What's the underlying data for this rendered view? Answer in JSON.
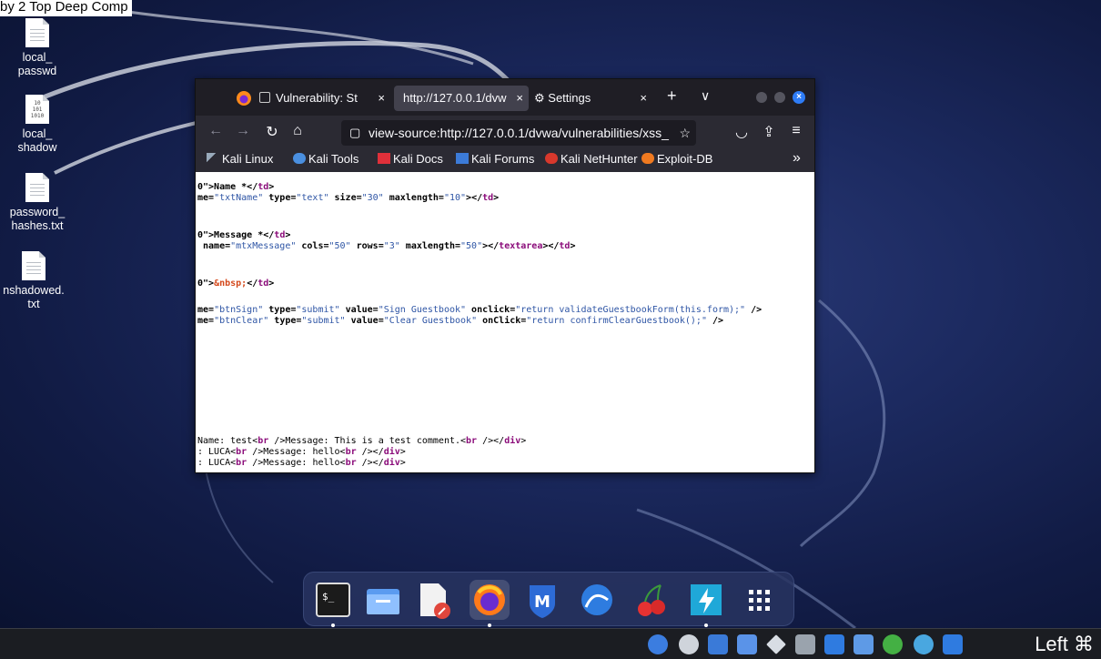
{
  "caption": "by 2 Top Deep Comp",
  "desktop_icons": [
    {
      "label1": "local_",
      "label2": "passwd",
      "kind": "text"
    },
    {
      "label1": "local_",
      "label2": "shadow",
      "kind": "binary"
    },
    {
      "label1": "password_",
      "label2": "hashes.txt",
      "kind": "text"
    },
    {
      "label1": "nshadowed.",
      "label2": "txt",
      "kind": "text"
    }
  ],
  "browser": {
    "tabs": [
      {
        "label": "Vulnerability: St"
      },
      {
        "label": "http://127.0.0.1/dvw"
      },
      {
        "label": "Settings"
      }
    ],
    "new_tab": "+",
    "tab_list": "∨",
    "url": "view-source:http://127.0.0.1/dvwa/vulnerabilities/xss_",
    "bookmarks": [
      "Kali Linux",
      "Kali Tools",
      "Kali Docs",
      "Kali Forums",
      "Kali NetHunter",
      "Exploit-DB"
    ],
    "bookmarks_overflow": "»"
  },
  "source_lines": {
    "l1a": "0\">Name *</",
    "l1b": "td",
    "l1c": ">",
    "l2a": "me=",
    "l2b": "\"txtName\"",
    "l2c": " type=",
    "l2d": "\"text\"",
    "l2e": " size=",
    "l2f": "\"30\"",
    "l2g": " maxlength=",
    "l2h": "\"10\"",
    "l2i": "></",
    "l2j": "td",
    "l2k": ">",
    "l3a": "0\">Message *</",
    "l3b": "td",
    "l3c": ">",
    "l4a": " name=",
    "l4b": "\"mtxMessage\"",
    "l4c": " cols=",
    "l4d": "\"50\"",
    "l4e": " rows=",
    "l4f": "\"3\"",
    "l4g": " maxlength=",
    "l4h": "\"50\"",
    "l4i": "></",
    "l4j": "textarea",
    "l4k": "></",
    "l4l": "td",
    "l4m": ">",
    "l5a": "0\">",
    "l5b": "&nbsp;",
    "l5c": "</",
    "l5d": "td",
    "l5e": ">",
    "l6a": "me=",
    "l6b": "\"btnSign\"",
    "l6c": " type=",
    "l6d": "\"submit\"",
    "l6e": " value=",
    "l6f": "\"Sign Guestbook\"",
    "l6g": " onclick=",
    "l6h": "\"return validateGuestbookForm(this.form);\"",
    "l6i": " />",
    "l7a": "me=",
    "l7b": "\"btnClear\"",
    "l7c": " type=",
    "l7d": "\"submit\"",
    "l7e": " value=",
    "l7f": "\"Clear Guestbook\"",
    "l7g": " onClick=",
    "l7h": "\"return confirmClearGuestbook();\"",
    "l7i": " />",
    "l8a": "Name: test<",
    "l8b": "br",
    "l8c": " />Message: This is a test comment.<",
    "l8d": "br",
    "l8e": " /></",
    "l8f": "div",
    "l8g": ">",
    "l9a": ": LUCA<",
    "l9b": "br",
    "l9c": " />Message: hello<",
    "l9d": "br",
    "l9e": " /></",
    "l9f": "div",
    "l9g": ">",
    "l10a": ": LUCA<",
    "l10b": "br",
    "l10c": " />Message: hello<",
    "l10d": "br",
    "l10e": " /></",
    "l10f": "div",
    "l10g": ">"
  },
  "panel": {
    "keyboard_layout": "Left ⌘"
  },
  "colors": {
    "tag": "#8b0c7a",
    "value": "#2e55a5",
    "entity": "#d4491c",
    "desktop": "#1c2a60"
  }
}
